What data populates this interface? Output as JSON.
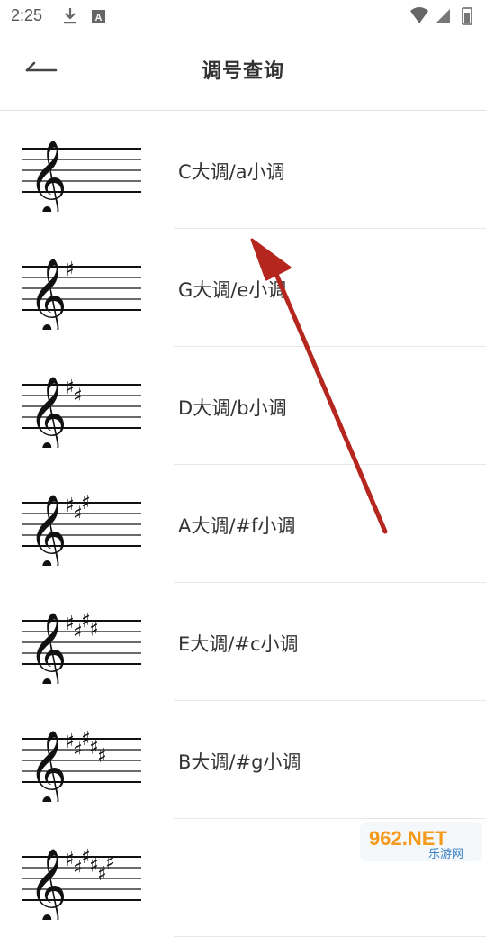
{
  "status_bar": {
    "time": "2:25"
  },
  "header": {
    "title": "调号查询"
  },
  "keys": [
    {
      "label": "C大调/a小调",
      "sharps": 0
    },
    {
      "label": "G大调/e小调",
      "sharps": 1
    },
    {
      "label": "D大调/b小调",
      "sharps": 2
    },
    {
      "label": "A大调/#f小调",
      "sharps": 3
    },
    {
      "label": "E大调/#c小调",
      "sharps": 4
    },
    {
      "label": "B大调/#g小调",
      "sharps": 5
    },
    {
      "label": "",
      "sharps": 6
    }
  ],
  "watermark": {
    "brand": "962.NET",
    "caption": "乐游网"
  },
  "colors": {
    "arrow": "#b5261e",
    "divider": "#e8e8e8",
    "text": "#333333"
  }
}
